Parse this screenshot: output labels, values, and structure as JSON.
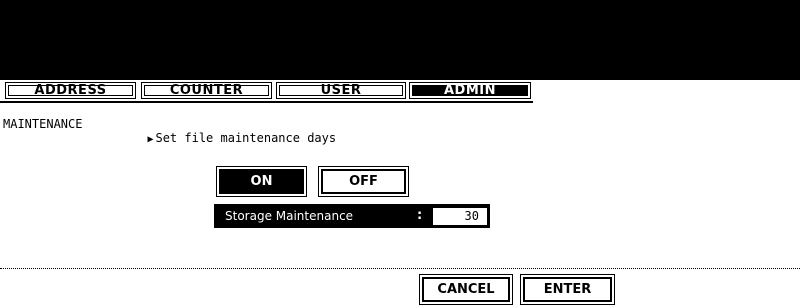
{
  "tabs": [
    {
      "label": "ADDRESS",
      "active": false
    },
    {
      "label": "COUNTER",
      "active": false
    },
    {
      "label": "USER",
      "active": false
    },
    {
      "label": "ADMIN",
      "active": true
    }
  ],
  "breadcrumb": {
    "section": "MAINTENANCE",
    "arrow": "▶",
    "title": "Set file maintenance days"
  },
  "toggle": {
    "on_label": "ON",
    "off_label": "OFF",
    "selected": "ON"
  },
  "storage": {
    "label": "Storage Maintenance",
    "separator": ":",
    "value": "30"
  },
  "footer": {
    "cancel_label": "CANCEL",
    "enter_label": "ENTER"
  },
  "colors": {
    "background": "#ffffff",
    "band": "#000000",
    "text": "#000000"
  }
}
